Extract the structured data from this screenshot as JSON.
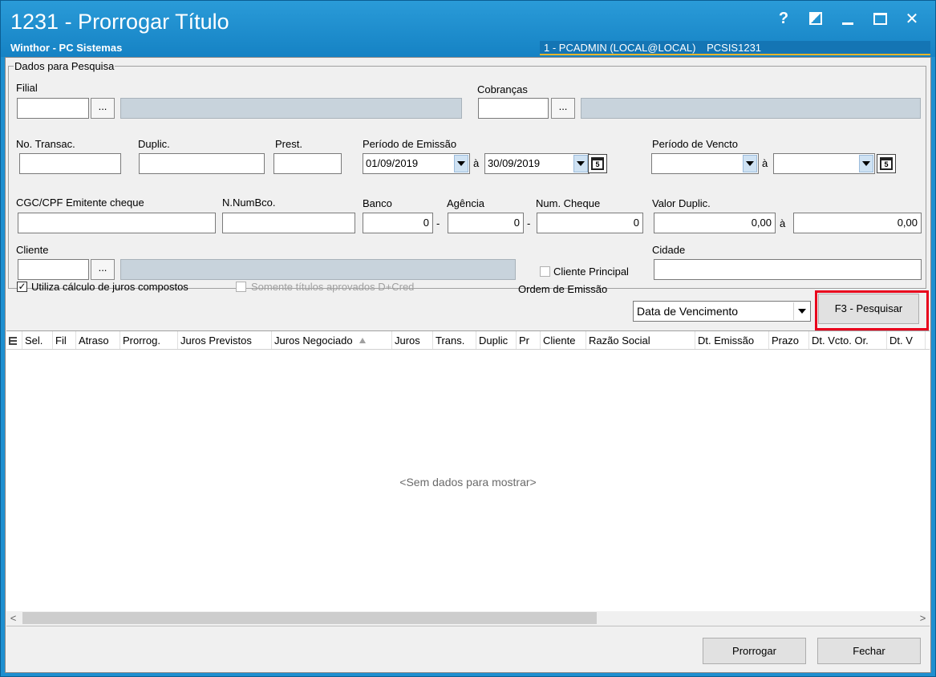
{
  "window": {
    "title": "1231 - Prorrogar Título",
    "subtitle": "Winthor - PC Sistemas",
    "user_info": "1 - PCADMIN (LOCAL@LOCAL)",
    "routine_code": "PCSIS1231",
    "controls": [
      "help-icon",
      "restore-icon",
      "minimize-icon",
      "maximize-icon",
      "close-icon"
    ],
    "help_label": "?",
    "close_label": "✕"
  },
  "colors": {
    "titlebar": "#1e8fd0",
    "highlight": "#e8001c",
    "readonly_field": "#c8d3dc"
  },
  "search": {
    "group_title": "Dados para Pesquisa",
    "filial_label": "Filial",
    "filial_value": "",
    "cobrancas_label": "Cobranças",
    "cobrancas_value": "",
    "dots_label": "...",
    "no_transac_label": "No. Transac.",
    "duplic_label": "Duplic.",
    "prest_label": "Prest.",
    "periodo_emissao_label": "Período de Emissão",
    "emissao_inicio": "01/09/2019",
    "emissao_fim": "30/09/2019",
    "periodo_vencto_label": "Período de Vencto",
    "vencto_inicio": "",
    "vencto_fim": "",
    "range_sep": "à",
    "cgc_label": "CGC/CPF Emitente cheque",
    "numbco_label": "N.NumBco.",
    "banco_label": "Banco",
    "banco_value": "0",
    "agencia_label": "Agência",
    "agencia_value": "0",
    "num_cheque_label": "Num. Cheque",
    "num_cheque_value": "0",
    "dash": "-",
    "valor_duplic_label": "Valor Duplic.",
    "valor_inicio": "0,00",
    "valor_fim": "0,00",
    "cliente_label": "Cliente",
    "cliente_principal_label": "Cliente Principal",
    "cliente_principal_checked": false,
    "cidade_label": "Cidade",
    "cidade_value": "",
    "calendar_glyph": "5"
  },
  "options": {
    "juros_compostos_label": "Utiliza cálculo de juros compostos",
    "juros_compostos_checked": true,
    "aprovados_label": "Somente títulos aprovados D+Cred",
    "aprovados_checked": false,
    "ordem_label": "Ordem de Emissão",
    "ordem_value": "Data de Vencimento",
    "pesquisar_label": "F3 - Pesquisar"
  },
  "grid": {
    "columns": [
      "Sel.",
      "Fil",
      "Atraso",
      "Prorrog.",
      "Juros Previstos",
      "Juros Negociado",
      "Juros",
      "Trans.",
      "Duplic",
      "Pr",
      "Cliente",
      "Razão Social",
      "Dt. Emissão",
      "Prazo",
      "Dt. Vcto. Or.",
      "Dt. V"
    ],
    "sorted_column": "Juros Negociado",
    "empty_text": "<Sem dados para mostrar>",
    "left_arrow": "<",
    "right_arrow": ">"
  },
  "footer": {
    "prorrogar_label": "Prorrogar",
    "fechar_label": "Fechar"
  }
}
